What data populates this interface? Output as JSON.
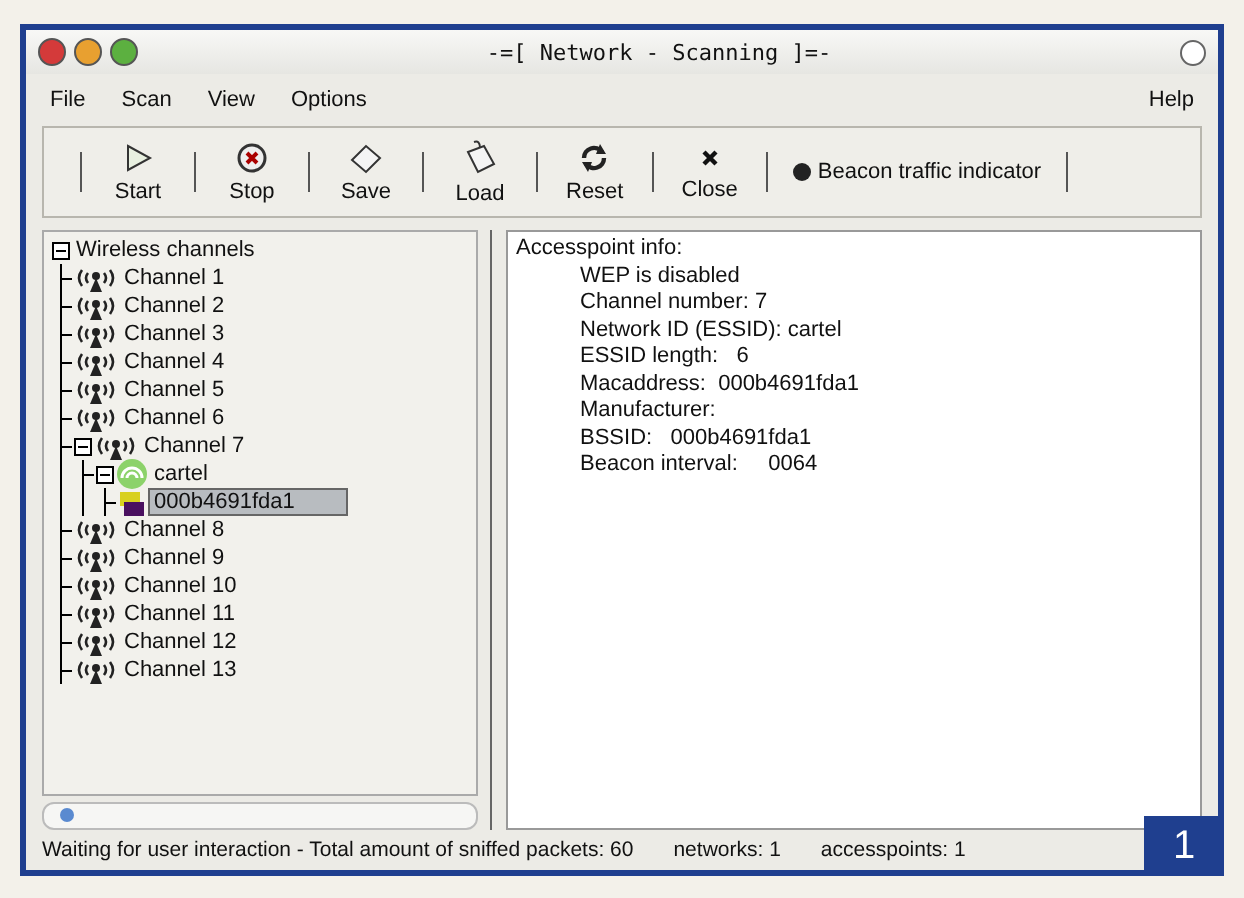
{
  "window": {
    "title": "-=[ Network - Scanning ]=-"
  },
  "menu": [
    {
      "label": "File"
    },
    {
      "label": "Scan"
    },
    {
      "label": "View"
    },
    {
      "label": "Options"
    }
  ],
  "help_menu": {
    "label": "Help"
  },
  "toolbar": [
    {
      "kind": "start",
      "label": "Start"
    },
    {
      "kind": "stop",
      "label": "Stop"
    },
    {
      "kind": "save",
      "label": "Save"
    },
    {
      "kind": "load",
      "label": "Load"
    },
    {
      "kind": "reset",
      "label": "Reset"
    },
    {
      "kind": "close",
      "label": "Close"
    }
  ],
  "beacon_indicator": {
    "label": "Beacon traffic indicator"
  },
  "tree": {
    "label": "Wireless channels",
    "expanded": true,
    "selected": false,
    "children": [
      {
        "label": "Channel 1",
        "kind": "channel",
        "selected": false
      },
      {
        "label": "Channel 2",
        "kind": "channel",
        "selected": false
      },
      {
        "label": "Channel 3",
        "kind": "channel",
        "selected": false
      },
      {
        "label": "Channel 4",
        "kind": "channel",
        "selected": false
      },
      {
        "label": "Channel 5",
        "kind": "channel",
        "selected": false
      },
      {
        "label": "Channel 6",
        "kind": "channel",
        "selected": false
      },
      {
        "label": "Channel 7",
        "kind": "channel",
        "selected": false,
        "expanded": true,
        "children": [
          {
            "label": "cartel",
            "kind": "network",
            "selected": false,
            "expanded": true,
            "children": [
              {
                "label": "000b4691fda1",
                "kind": "accesspoint",
                "selected": true
              }
            ]
          }
        ]
      },
      {
        "label": "Channel 8",
        "kind": "channel",
        "selected": false
      },
      {
        "label": "Channel 9",
        "kind": "channel",
        "selected": false
      },
      {
        "label": "Channel 10",
        "kind": "channel",
        "selected": false
      },
      {
        "label": "Channel 11",
        "kind": "channel",
        "selected": false
      },
      {
        "label": "Channel 12",
        "kind": "channel",
        "selected": false
      },
      {
        "label": "Channel 13",
        "kind": "channel",
        "selected": false
      }
    ]
  },
  "info": {
    "heading": "Accesspoint info:",
    "lines": [
      "WEP is disabled",
      "Channel number: 7",
      "Network ID (ESSID): cartel",
      "ESSID length:   6",
      "Macaddress:  000b4691fda1",
      "Manufacturer:",
      "BSSID:   000b4691fda1",
      "Beacon interval:     0064"
    ]
  },
  "status_bar": [
    "Waiting for user interaction - Total amount of sniffed packets: 60",
    "networks: 1",
    "accesspoints: 1"
  ],
  "figure_number": "1"
}
